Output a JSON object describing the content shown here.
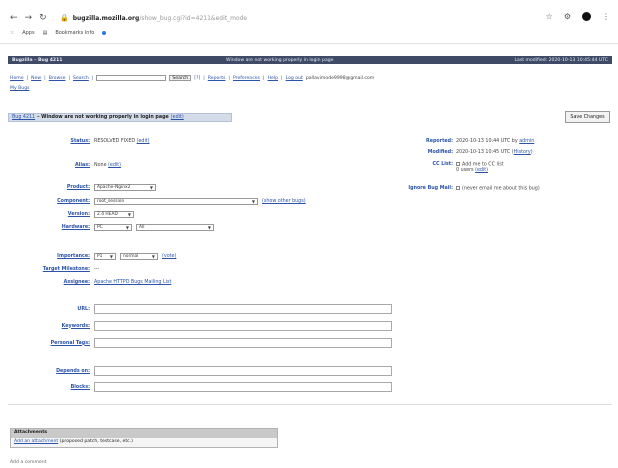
{
  "browser": {
    "host": "bugzilla.mozilla.org",
    "path": "/show_bug.cgi?id=4211&edit_mode",
    "bookmarks": [
      "Apps",
      "Bookmarks Info"
    ]
  },
  "bugzilla": {
    "header_left": "Bugzilla – Bug 4211",
    "header_mid": "Window are not working properly in login page",
    "header_right": "Last modified: 2020-10-13 10:45:44 UTC",
    "links": [
      "Home",
      "New",
      "Browse",
      "Search"
    ],
    "search_button": "Search",
    "links_right": [
      "Reports",
      "Preferences",
      "Help",
      "Log out"
    ],
    "user": "pallavimode9998@gmail.com",
    "help_link": "My Bugs"
  },
  "summary": {
    "bug_id": "Bug 4211",
    "title": " – Window are not working properly in login page",
    "edit": "(edit)",
    "save_button": "Save Changes"
  },
  "fields": {
    "status_label": "Status:",
    "status_value": "RESOLVED FIXED",
    "status_edit": "(edit)",
    "alias_label": "Alias:",
    "alias_value": "None",
    "alias_edit": "(edit)",
    "product_label": "Product:",
    "product_value": "Apache-Nginx2",
    "component_label": "Component:",
    "component_value": "root_session",
    "component_link": "(show other bugs)",
    "version_label": "Version:",
    "version_value": "2.4 HEAD",
    "hardware_label": "Hardware:",
    "hardware_value": "PC",
    "os_value": "All",
    "importance_label": "Importance:",
    "priority_value": "P1",
    "severity_value": "normal",
    "importance_link": "(vote)",
    "milestone_label": "Target Milestone:",
    "milestone_value": "---",
    "assignee_label": "Assignee:",
    "assignee_value": "Apache HTTPD Bugs Mailing List",
    "url_label": "URL:",
    "keywords_label": "Keywords:",
    "personal_tags_label": "Personal Tags:",
    "depends_label": "Depends on:",
    "blocks_label": "Blocks:"
  },
  "right": {
    "reported_label": "Reported:",
    "reported_value": "2020-10-13 10:44 UTC by ",
    "reported_by": "admin",
    "modified_label": "Modified:",
    "modified_value": "2020-10-13 10:45 UTC (",
    "modified_history": "History",
    "cc_label": "CC List:",
    "cc_add": "Add me to CC list",
    "cc_users": "0 users ",
    "cc_edit": "(edit)",
    "ignore_label": "Ignore Bug Mail:",
    "ignore_text": "(never email me about this bug)"
  },
  "attachments": {
    "header": "Attachments",
    "add_link": "Add an attachment",
    "add_note": " (proposed patch, testcase, etc.)"
  },
  "footer": "Add a comment"
}
